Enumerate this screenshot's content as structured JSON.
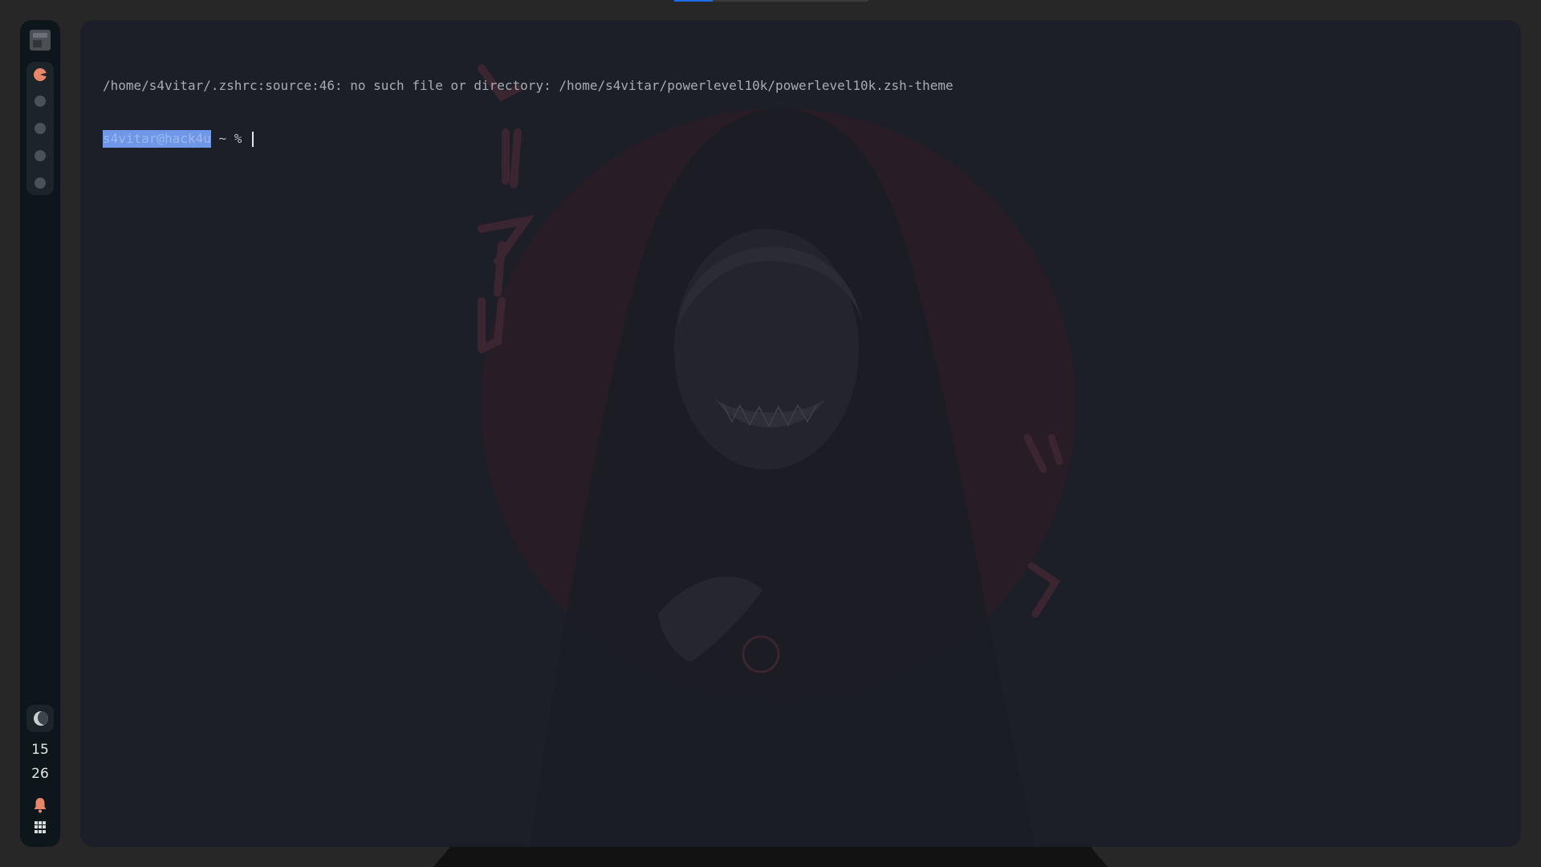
{
  "topbar": {
    "accent_color": "#1f6feb"
  },
  "sidebar": {
    "launcher_icon": "app-launcher-icon",
    "workspaces": [
      {
        "index": 1,
        "active": true,
        "color": "#e8866b"
      },
      {
        "index": 2,
        "active": false
      },
      {
        "index": 3,
        "active": false
      },
      {
        "index": 4,
        "active": false
      },
      {
        "index": 5,
        "active": false
      }
    ],
    "night_mode_icon": "moon-icon",
    "clock": {
      "hour": "15",
      "minute": "26"
    },
    "notification_icon": "bell-icon",
    "notification_color": "#e8866b",
    "apps_icon": "grid-icon"
  },
  "terminal": {
    "error_line": "/home/s4vitar/.zshrc:source:46: no such file or directory: /home/s4vitar/powerlevel10k/powerlevel10k.zsh-theme",
    "prompt_user": "s4vitar@hack4u",
    "prompt_rest": " ~ % ",
    "selection_color": "#6f97e8"
  }
}
